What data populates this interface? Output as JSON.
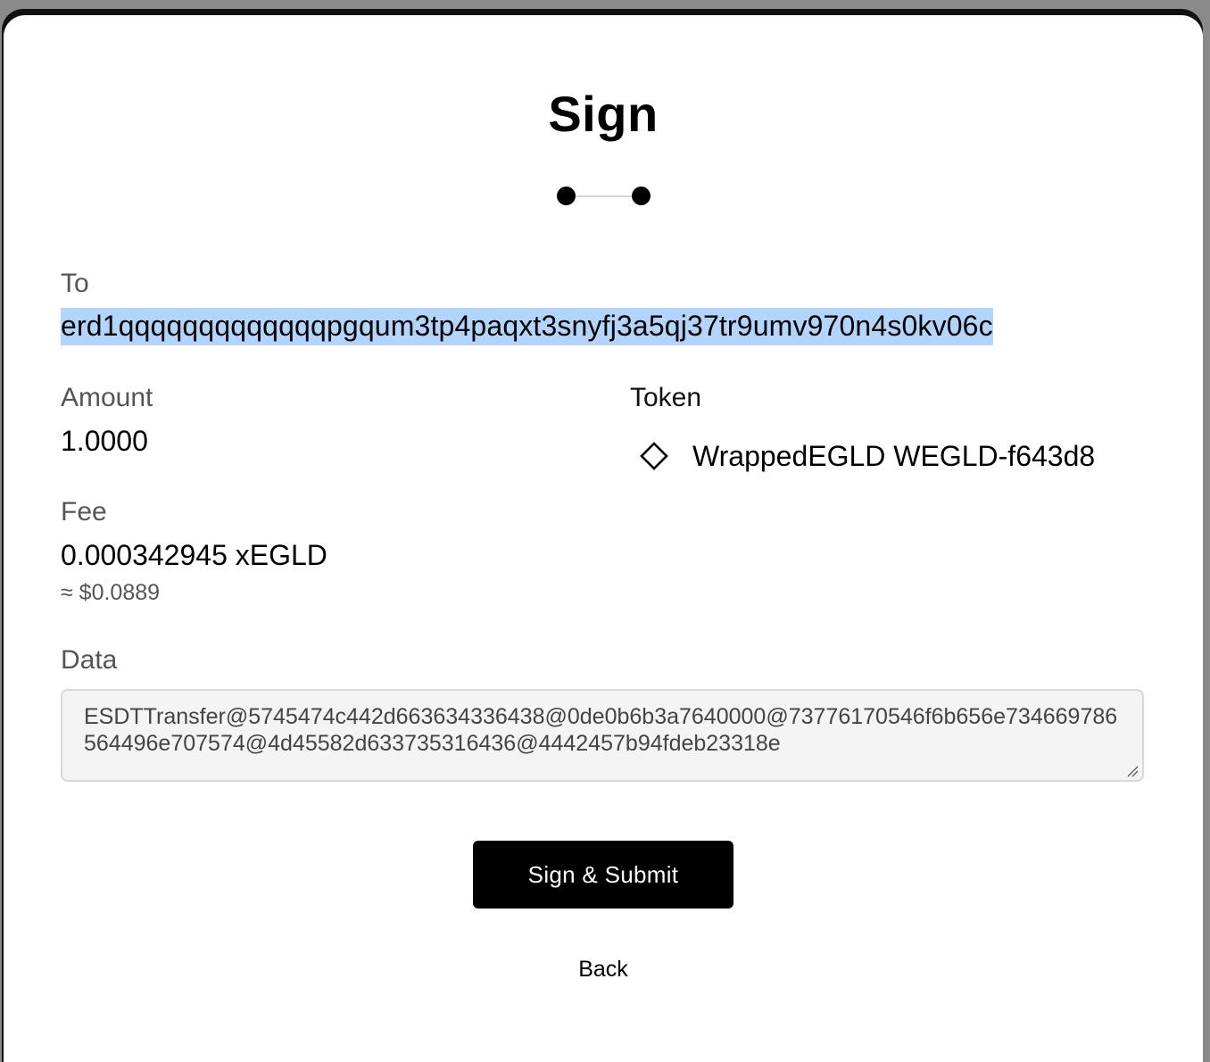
{
  "modal": {
    "title": "Sign",
    "steps_total": 2
  },
  "to": {
    "label": "To",
    "address": "erd1qqqqqqqqqqqqqpgqum3tp4paqxt3snyfj3a5qj37tr9umv970n4s0kv06c"
  },
  "amount": {
    "label": "Amount",
    "value": "1.0000"
  },
  "token": {
    "label": "Token",
    "icon": "diamond-icon",
    "value": "WrappedEGLD WEGLD-f643d8"
  },
  "fee": {
    "label": "Fee",
    "value": "0.000342945 xEGLD",
    "usd": "≈ $0.0889"
  },
  "data_field": {
    "label": "Data",
    "value": "ESDTTransfer@5745474c442d663634336438@0de0b6b3a7640000@73776170546f6b656e734669786564496e707574@4d45582d633735316436@4442457b94fdeb23318e"
  },
  "actions": {
    "submit_label": "Sign & Submit",
    "back_label": "Back"
  },
  "colors": {
    "selection": "#b3d4fc",
    "primary": "#000000"
  }
}
